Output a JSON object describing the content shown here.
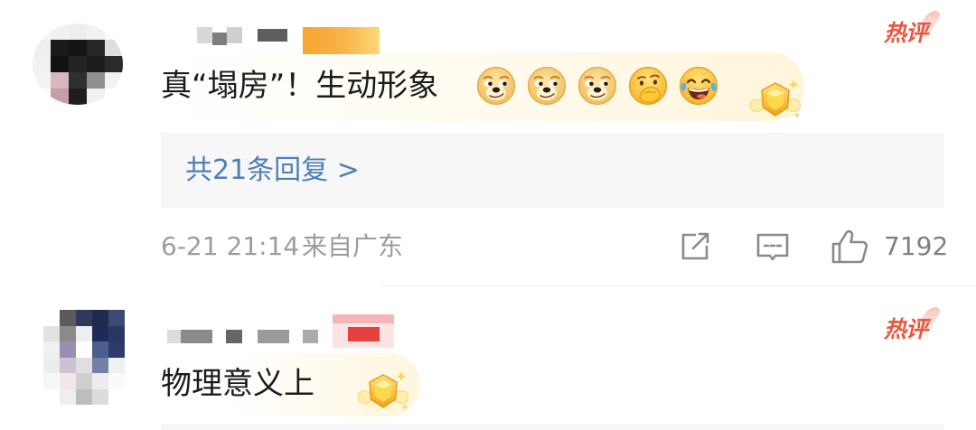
{
  "colors": {
    "text": "#1b1b1b",
    "link": "#4d7fb8",
    "hot_tag": "#e9573f",
    "meta": "#9c9c9c",
    "icon": "#8a8a8a",
    "reply_background": "#f7f7f7"
  },
  "comments": [
    {
      "hot_tag": "热评",
      "text": "真“塌房”！生动形象",
      "emojis": [
        "doge-emoji-icon",
        "doge-emoji-icon",
        "doge-emoji-icon",
        "thinking-face-emoji-icon",
        "laugh-cry-emoji-icon"
      ],
      "badge_icon": "gold-fan-badge-icon",
      "replies_link": "共21条回复 >",
      "time": "6-21 21:14",
      "location": "来自广东",
      "actions": {
        "share_icon": "share-icon",
        "comment_icon": "comment-icon",
        "like_icon": "thumbs-up-icon",
        "like_count": "7192"
      }
    },
    {
      "hot_tag": "热评",
      "text": "物理意义上",
      "badge_icon": "gold-fan-badge-icon"
    }
  ]
}
